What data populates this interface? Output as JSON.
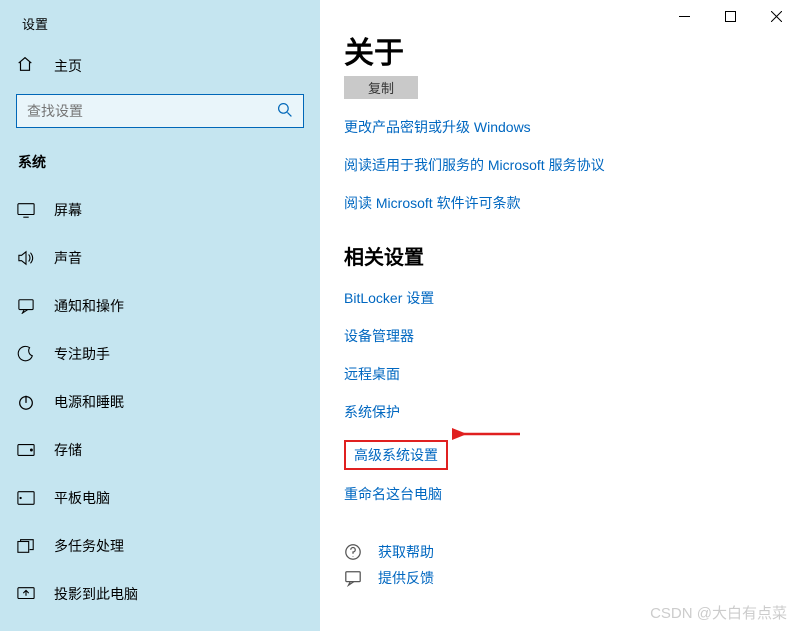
{
  "window": {
    "title": "设置"
  },
  "sidebar": {
    "home_label": "主页",
    "search_placeholder": "查找设置",
    "category": "系统",
    "items": [
      {
        "icon": "display-icon",
        "label": "屏幕"
      },
      {
        "icon": "sound-icon",
        "label": "声音"
      },
      {
        "icon": "notifications-icon",
        "label": "通知和操作"
      },
      {
        "icon": "focus-icon",
        "label": "专注助手"
      },
      {
        "icon": "power-icon",
        "label": "电源和睡眠"
      },
      {
        "icon": "storage-icon",
        "label": "存储"
      },
      {
        "icon": "tablet-icon",
        "label": "平板电脑"
      },
      {
        "icon": "multitask-icon",
        "label": "多任务处理"
      },
      {
        "icon": "project-icon",
        "label": "投影到此电脑"
      }
    ]
  },
  "content": {
    "heading": "关于",
    "copy_label": "复制",
    "links": [
      "更改产品密钥或升级 Windows",
      "阅读适用于我们服务的 Microsoft 服务协议",
      "阅读 Microsoft 软件许可条款"
    ],
    "related_heading": "相关设置",
    "related_links": [
      "BitLocker 设置",
      "设备管理器",
      "远程桌面",
      "系统保护"
    ],
    "highlighted_link": "高级系统设置",
    "rename_link": "重命名这台电脑",
    "actions": {
      "help": "获取帮助",
      "feedback": "提供反馈"
    }
  },
  "watermark": "CSDN @大白有点菜"
}
